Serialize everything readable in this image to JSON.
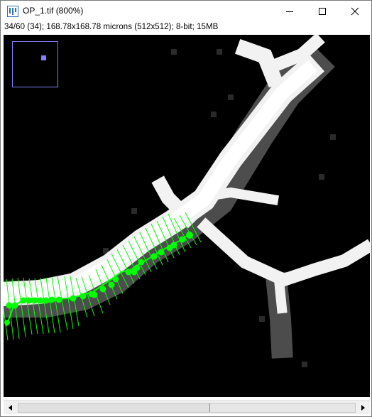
{
  "window": {
    "title": "OP_1.tif (800%)",
    "buttons": {
      "minimize": "minimize-icon",
      "maximize": "maximize-icon",
      "close": "close-icon"
    }
  },
  "image_info": "34/60 (34); 168.78x168.78 microns (512x512); 8-bit; 15MB",
  "overlay": {
    "color": "#00ff00",
    "navigator_color": "#8080ff"
  },
  "scrollbar": {
    "position_fraction": 0.57,
    "left_icon": "arrow-left-icon",
    "right_icon": "arrow-right-icon"
  }
}
